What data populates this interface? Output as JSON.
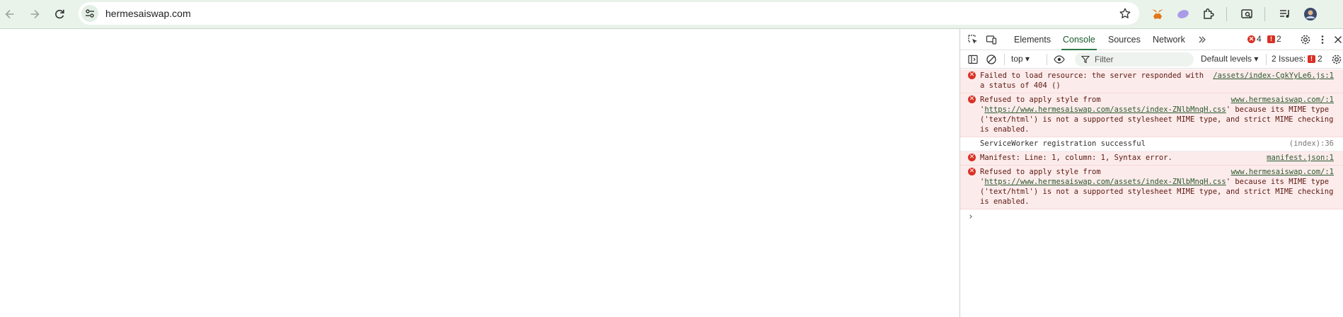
{
  "browser": {
    "url": "hermesaiswap.com"
  },
  "devtools": {
    "tabs": [
      "Elements",
      "Console",
      "Sources",
      "Network"
    ],
    "active_tab": "Console",
    "error_count": "4",
    "issue_count": "2",
    "context": "top",
    "filter_placeholder": "Filter",
    "levels": "Default levels",
    "issues_label": "2 Issues:",
    "issues_badge": "2"
  },
  "console": {
    "messages": [
      {
        "level": "error",
        "text": "Failed to load resource: the server responded with a status of 404 ()",
        "source": "/assets/index-CgkYyLe6.js:1"
      },
      {
        "level": "error",
        "prefix": "Refused to apply style from '",
        "link": "https://www.hermesaiswap.com/assets/index-ZNlbMnqH.css",
        "suffix": "' because its MIME type ('text/html') is not a supported stylesheet MIME type, and strict MIME checking is enabled.",
        "source": "www.hermesaiswap.com/:1"
      },
      {
        "level": "info",
        "text": "ServiceWorker registration successful",
        "source": "(index):36"
      },
      {
        "level": "error",
        "text": "Manifest: Line: 1, column: 1, Syntax error.",
        "source": "manifest.json:1"
      },
      {
        "level": "error",
        "prefix": "Refused to apply style from '",
        "link": "https://www.hermesaiswap.com/assets/index-ZNlbMnqH.css",
        "suffix": "' because its MIME type ('text/html') is not a supported stylesheet MIME type, and strict MIME checking is enabled.",
        "source": "www.hermesaiswap.com/:1"
      }
    ],
    "prompt": "›"
  }
}
